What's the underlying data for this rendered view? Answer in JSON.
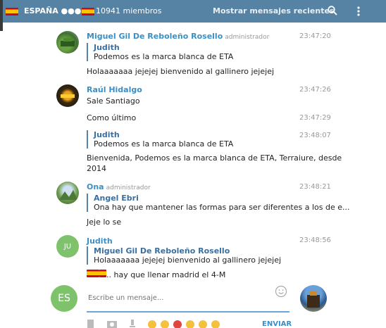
{
  "header": {
    "title": "ESPAÑA ●●●●",
    "members": "10941 miembros",
    "recent_label": "Mostrar mensajes recientes",
    "brand_color": "#5682a3"
  },
  "messages": [
    {
      "author": "Miguel Gil De Reboleño Rosello",
      "role": "administrador",
      "time": "23:47:20",
      "reply_name": "Judith",
      "reply_text": "Podemos es la marca blanca de ETA",
      "text": "Holaaaaaaa jejejej bienvenido al gallinero jejejej"
    },
    {
      "author": "Raúl Hidalgo",
      "time": "23:47:26",
      "text": "Sale Santiago"
    },
    {
      "time": "23:47:29",
      "text": "Como último"
    },
    {
      "time": "23:48:07",
      "reply_name": "Judith",
      "reply_text": "Podemos es la marca blanca de ETA",
      "text_line1": "Bienvenida, Podemos es la marca blanca de ETA, Terraiure, desde",
      "text_line2": "2014"
    },
    {
      "author": "Ona",
      "role": "administrador",
      "time": "23:48:21",
      "reply_name": "Angel Ebri",
      "reply_text": "Ona hay que mantener las formas para ser diferentes a los de e...",
      "text": "Jeje lo se"
    },
    {
      "author": "Judith",
      "avatar_initials": "JU",
      "time": "23:48:56",
      "reply_name": "Miguel Gil De Reboleño Rosello",
      "reply_text": "Holaaaaaaa jejejej bienvenido al gallinero jejejej",
      "text": ".. hay que llenar madrid el 4-M"
    }
  ],
  "composer": {
    "avatar_initials": "ES",
    "placeholder": "Escribe un mensaje...",
    "send_label": "ENVIAR"
  }
}
